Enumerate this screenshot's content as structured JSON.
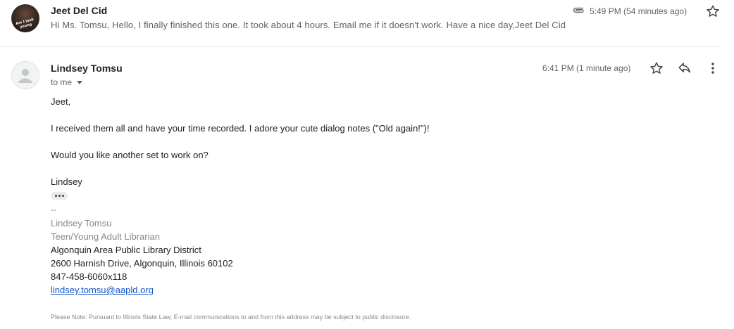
{
  "collapsed_message": {
    "sender": "Jeet Del Cid",
    "snippet": "Hi Ms. Tomsu, Hello, I finally finished this one. It took about 4 hours. Email me if it doesn't work. Have a nice day,Jeet Del Cid",
    "time": "5:49 PM (54 minutes ago)",
    "avatar_overlay_text": "Am I look young",
    "icons": {
      "attachment": "paperclip-icon",
      "star": "star-outline-icon"
    }
  },
  "expanded_message": {
    "sender": "Lindsey Tomsu",
    "recipient_label": "to me",
    "time": "6:41 PM (1 minute ago)",
    "icons": {
      "star": "star-outline-icon",
      "reply": "reply-icon",
      "more": "more-vert-icon",
      "avatar": "default-person-icon",
      "details": "caret-down-icon"
    },
    "body": {
      "greeting": "Jeet,",
      "paragraph1": "I received them all and have your time recorded. I adore your cute dialog notes (\"Old again!\")!",
      "paragraph2": "Would you like another set to work on?",
      "closing": "Lindsey"
    },
    "signature": {
      "separator": "--",
      "name": "Lindsey Tomsu",
      "title": "Teen/Young Adult Librarian",
      "organization": "Algonquin Area Public Library District",
      "address": "2600 Harnish Drive, Algonquin, Illinois 60102",
      "phone": "847-458-6060x118",
      "email": "lindsey.tomsu@aapld.org",
      "disclaimer": "Please Note: Pursuant to Illinois State Law, E-mail communications to and from this address may be subject to public disclosure."
    }
  },
  "colors": {
    "text_primary": "#202124",
    "text_secondary": "#5f6368",
    "signature_grey": "#888888",
    "link": "#1155cc",
    "divider": "#e8eaed"
  }
}
